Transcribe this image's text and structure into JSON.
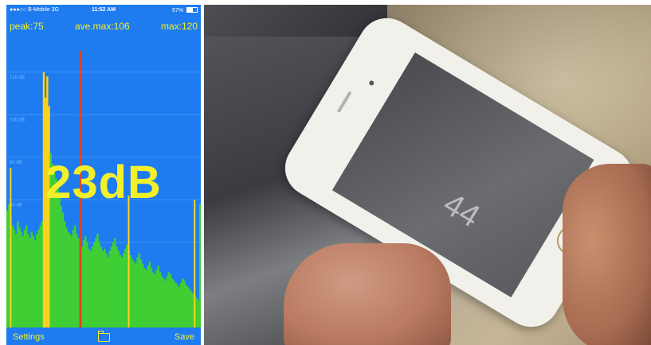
{
  "status_bar": {
    "carrier": "●●●○○ B-Mobile  3G",
    "time": "11:52 AM",
    "battery": "57%"
  },
  "stats": {
    "peak": "peak:75",
    "ave_max": "ave.max:106",
    "max": "max:120"
  },
  "readout": "23dB",
  "grid_labels": [
    "120 dB",
    "100 dB",
    "80 dB",
    "60 dB",
    "40 dB"
  ],
  "bottom_bar": {
    "settings": "Settings",
    "save": "Save",
    "folder_icon": "folder-icon"
  },
  "iphone_reading": "44",
  "colors": {
    "background": "#1e7cf0",
    "text": "#f3ef2b",
    "bars": "#3fcf34",
    "peak_bars": "#ffd21a",
    "max_line": "#e8421c"
  },
  "chart_data": {
    "type": "bar",
    "ylim": [
      0,
      130
    ],
    "values": [
      55,
      58,
      52,
      48,
      46,
      44,
      50,
      47,
      45,
      43,
      46,
      48,
      44,
      42,
      45,
      43,
      41,
      44,
      46,
      48,
      50,
      120,
      108,
      118,
      104,
      82,
      77,
      73,
      70,
      66,
      61,
      57,
      54,
      50,
      47,
      45,
      44,
      43,
      46,
      48,
      44,
      42,
      40,
      38,
      41,
      43,
      40,
      37,
      36,
      38,
      40,
      42,
      44,
      40,
      38,
      36,
      37,
      35,
      33,
      36,
      38,
      40,
      42,
      38,
      36,
      34,
      33,
      35,
      37,
      39,
      36,
      34,
      32,
      31,
      30,
      33,
      35,
      32,
      30,
      28,
      27,
      29,
      31,
      28,
      26,
      25,
      27,
      29,
      26,
      24,
      23,
      22,
      24,
      26,
      25,
      23,
      22,
      21,
      20,
      19,
      21,
      23,
      22,
      20,
      19,
      18,
      17,
      16,
      15,
      14,
      13,
      58
    ],
    "peak_lines": [
      {
        "index": 2,
        "value": 75
      },
      {
        "index": 70,
        "value": 62
      },
      {
        "index": 108,
        "value": 60
      }
    ],
    "max_line_index": 42
  }
}
